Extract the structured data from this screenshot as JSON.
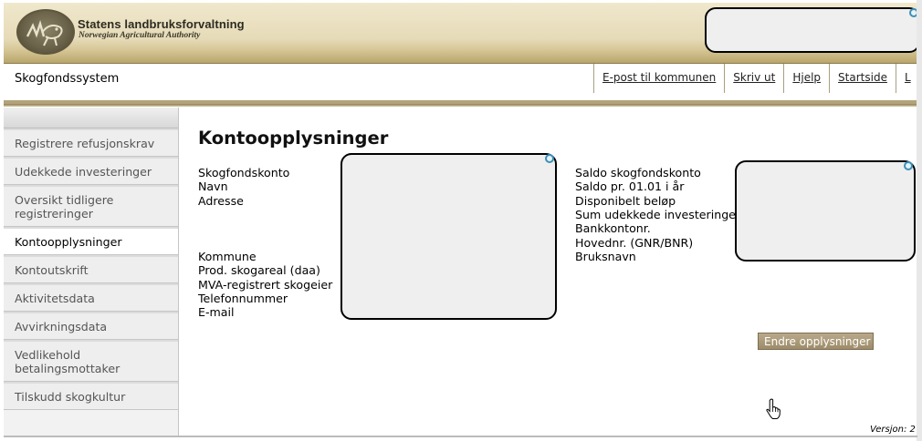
{
  "header": {
    "org_title": "Statens landbruksforvaltning",
    "org_subtitle": "Norwegian Agricultural Authority"
  },
  "navbar": {
    "system_name": "Skogfondssystem",
    "links": [
      "E-post til kommunen",
      "Skriv ut",
      "Hjelp",
      "Startside",
      "L"
    ]
  },
  "sidebar": {
    "items": [
      {
        "label": "Registrere refusjonskrav",
        "active": false
      },
      {
        "label": "Udekkede investeringer",
        "active": false
      },
      {
        "label": "Oversikt tidligere registreringer",
        "active": false
      },
      {
        "label": "Kontoopplysninger",
        "active": true
      },
      {
        "label": "Kontoutskrift",
        "active": false
      },
      {
        "label": "Aktivitetsdata",
        "active": false
      },
      {
        "label": "Avvirkningsdata",
        "active": false
      },
      {
        "label": "Vedlikehold betalingsmottaker",
        "active": false
      },
      {
        "label": "Tilskudd skogkultur",
        "active": false
      }
    ]
  },
  "main": {
    "title": "Kontoopplysninger",
    "left_labels_top": [
      "Skogfondskonto",
      "Navn",
      "Adresse"
    ],
    "left_labels_bottom": [
      "Kommune",
      "Prod. skogareal (daa)",
      "MVA-registrert skogeier",
      "Telefonnummer",
      "E-mail"
    ],
    "right_labels": [
      "Saldo skogfondskonto",
      "Saldo pr. 01.01 i år",
      "Disponibelt beløp",
      "Sum udekkede investeringer",
      "Bankkontonr.",
      "Hovednr. (GNR/BNR)",
      "Bruksnavn"
    ],
    "edit_button": "Endre opplysninger",
    "version": "Versjon: 2"
  },
  "colors": {
    "banner": "#e6dbb8",
    "accent": "#b3a37a",
    "button": "#a8987a"
  }
}
